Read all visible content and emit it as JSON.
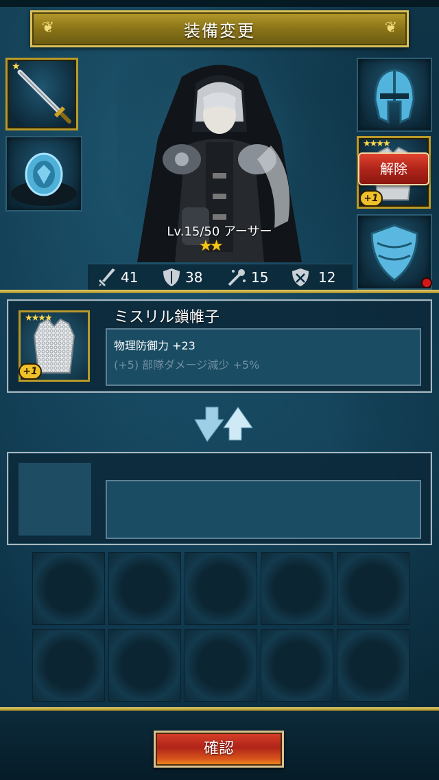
{
  "header": {
    "title": "装備変更"
  },
  "character": {
    "level_label": "Lv.15/50 アーサー",
    "stars": "★★",
    "stats": {
      "attack": "41",
      "defense": "38",
      "magic": "15",
      "magic_defense": "12"
    }
  },
  "slots": {
    "weapon": {
      "icon": "sword-icon",
      "stars": "★"
    },
    "accessory": {
      "icon": "ring-icon"
    },
    "helmet": {
      "icon": "helmet-icon"
    },
    "armor": {
      "icon": "chainmail-icon",
      "stars": "★★★★",
      "plus": "+1",
      "release_label": "解除"
    },
    "shield": {
      "icon": "shield-icon"
    }
  },
  "current_item": {
    "name": "ミスリル鎖帷子",
    "stars": "★★★★",
    "plus": "+1",
    "effect1": "物理防御力 +23",
    "effect2": "(+5) 部隊ダメージ減少 +5%"
  },
  "footer": {
    "confirm_label": "確認"
  },
  "colors": {
    "gold": "#b89a2a",
    "panel_bg": "#1a4c63",
    "button_red": "#b02418"
  }
}
